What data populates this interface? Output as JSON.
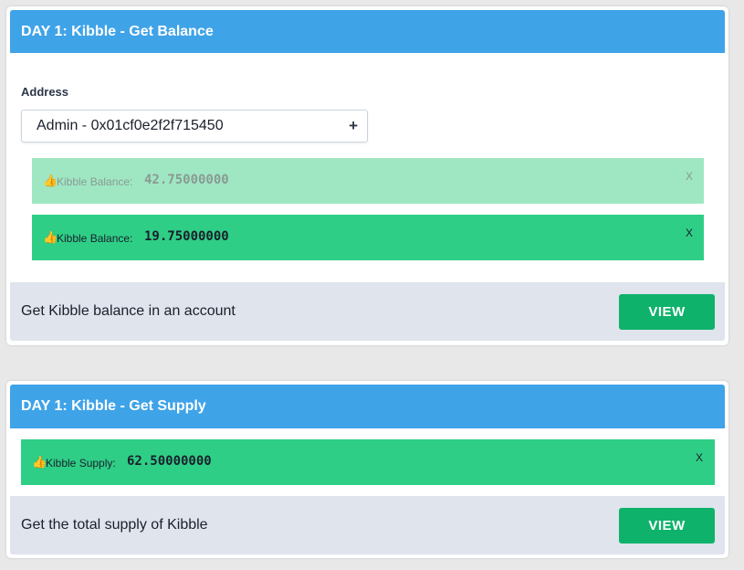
{
  "balance_card": {
    "title": "DAY 1: Kibble - Get Balance",
    "address_label": "Address",
    "address_value": "Admin - 0x01cf0e2f2f715450",
    "add_icon": "+",
    "alerts": [
      {
        "icon": "👍",
        "label": "Kibble Balance:",
        "value": "42.75000000",
        "close": "X"
      },
      {
        "icon": "👍",
        "label": "Kibble Balance:",
        "value": "19.75000000",
        "close": "X"
      }
    ],
    "description": "Get Kibble balance in an account",
    "button_label": "VIEW"
  },
  "supply_card": {
    "title": "DAY 1: Kibble - Get Supply",
    "alerts": [
      {
        "icon": "👍",
        "label": "Kibble Supply:",
        "value": "62.50000000",
        "close": "X"
      }
    ],
    "description": "Get the total supply of Kibble",
    "button_label": "VIEW"
  },
  "colors": {
    "header": "#3fa3e8",
    "alert_faded": "#9fe7c3",
    "alert_solid": "#2fce86",
    "button": "#0fb26b",
    "footer": "#dfe4ed"
  }
}
